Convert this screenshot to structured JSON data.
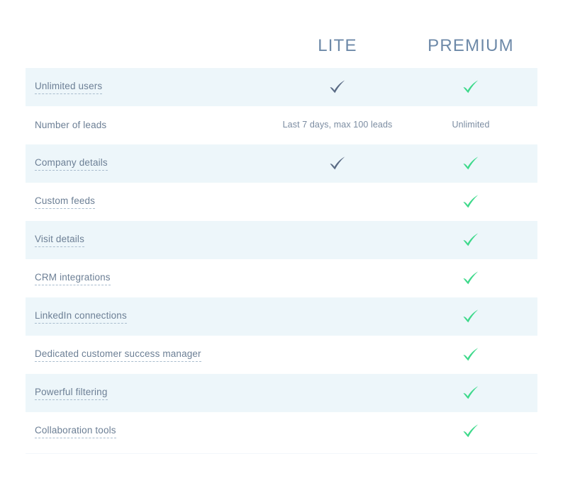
{
  "table": {
    "columns": [
      {
        "key": "feature",
        "label": "",
        "align": "left"
      },
      {
        "key": "lite",
        "label": "LITE",
        "align": "center"
      },
      {
        "key": "premium",
        "label": "PREMIUM",
        "align": "center"
      }
    ],
    "header": {
      "feature_label": "",
      "lite_label": "LITE",
      "premium_label": "PREMIUM"
    },
    "rows": [
      {
        "feature": "Unlimited users",
        "has_tooltip": true,
        "lite": {
          "type": "check",
          "style": "dark",
          "text": ""
        },
        "premium": {
          "type": "check",
          "style": "green",
          "text": ""
        }
      },
      {
        "feature": "Number of leads",
        "has_tooltip": false,
        "lite": {
          "type": "text",
          "style": "",
          "text": "Last 7 days, max 100 leads"
        },
        "premium": {
          "type": "text",
          "style": "",
          "text": "Unlimited"
        }
      },
      {
        "feature": "Company details",
        "has_tooltip": true,
        "lite": {
          "type": "check",
          "style": "dark",
          "text": ""
        },
        "premium": {
          "type": "check",
          "style": "green",
          "text": ""
        }
      },
      {
        "feature": "Custom feeds",
        "has_tooltip": true,
        "lite": {
          "type": "none",
          "style": "",
          "text": ""
        },
        "premium": {
          "type": "check",
          "style": "green",
          "text": ""
        }
      },
      {
        "feature": "Visit details",
        "has_tooltip": true,
        "lite": {
          "type": "none",
          "style": "",
          "text": ""
        },
        "premium": {
          "type": "check",
          "style": "green",
          "text": ""
        }
      },
      {
        "feature": "CRM integrations",
        "has_tooltip": true,
        "lite": {
          "type": "none",
          "style": "",
          "text": ""
        },
        "premium": {
          "type": "check",
          "style": "green",
          "text": ""
        }
      },
      {
        "feature": "LinkedIn connections",
        "has_tooltip": true,
        "lite": {
          "type": "none",
          "style": "",
          "text": ""
        },
        "premium": {
          "type": "check",
          "style": "green",
          "text": ""
        }
      },
      {
        "feature": "Dedicated customer success manager",
        "has_tooltip": true,
        "lite": {
          "type": "none",
          "style": "",
          "text": ""
        },
        "premium": {
          "type": "check",
          "style": "green",
          "text": ""
        }
      },
      {
        "feature": "Powerful filtering",
        "has_tooltip": true,
        "lite": {
          "type": "none",
          "style": "",
          "text": ""
        },
        "premium": {
          "type": "check",
          "style": "green",
          "text": ""
        }
      },
      {
        "feature": "Collaboration tools",
        "has_tooltip": true,
        "lite": {
          "type": "none",
          "style": "",
          "text": ""
        },
        "premium": {
          "type": "check",
          "style": "green",
          "text": ""
        }
      }
    ]
  },
  "icons": {
    "check_dark": "checkmark-icon",
    "check_green": "checkmark-icon"
  },
  "colors": {
    "page_background": "#ffffff",
    "row_stripe": "#edf6fa",
    "row_plain": "#ffffff",
    "header_text": "#6d89a8",
    "feature_text": "#6c7f95",
    "value_text": "#7b8ca1",
    "tooltip_underline": "#a9bccd",
    "check_dark": "#5a6b85",
    "check_green": "#3ed98b"
  }
}
